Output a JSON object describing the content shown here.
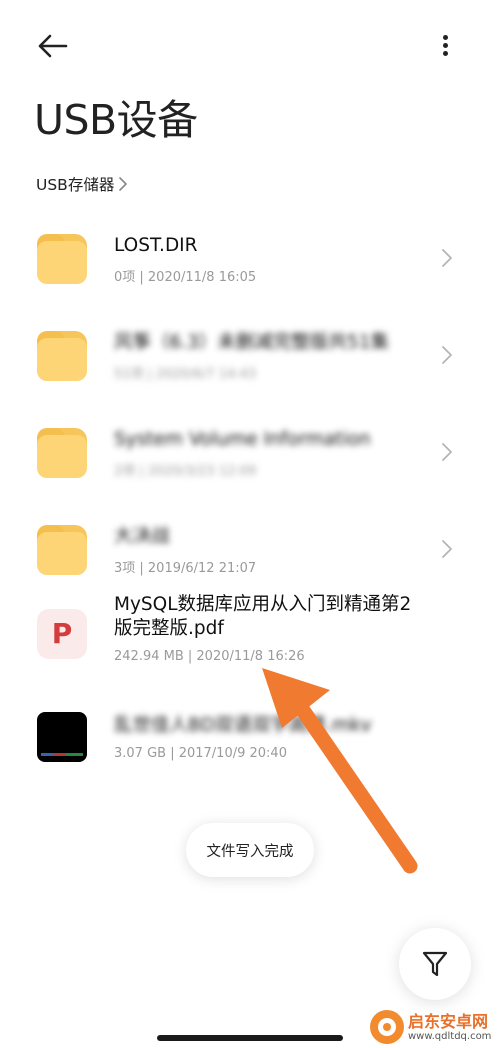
{
  "header": {
    "back_icon": "arrow-left-icon",
    "more_icon": "more-vertical-icon",
    "title": "USB设备"
  },
  "breadcrumb": {
    "label": "USB存储器",
    "chevron_icon": "chevron-right-icon"
  },
  "files": [
    {
      "name": "LOST.DIR",
      "meta": "0项 | 2020/11/8 16:05",
      "type": "folder",
      "blurred": false,
      "has_chevron": true
    },
    {
      "name": "风筝（6.3）未删减完整版共51集",
      "meta": "51项 | 2020/6/7 14:43",
      "type": "folder",
      "blurred": true,
      "has_chevron": true
    },
    {
      "name": "System Volume Information",
      "meta": "2项 | 2020/3/23 12:09",
      "type": "folder",
      "blurred": true,
      "has_chevron": true
    },
    {
      "name": "大决战",
      "meta": "3项 | 2019/6/12 21:07",
      "type": "folder",
      "blurred": true,
      "has_chevron": true
    },
    {
      "name": "MySQL数据库应用从入门到精通第2版完整版.pdf",
      "meta": "242.94 MB | 2020/11/8 16:26",
      "type": "pdf",
      "icon_letter": "P",
      "blurred": false,
      "has_chevron": false
    },
    {
      "name": "乱世佳人BD双语双字高清.mkv",
      "meta": "3.07 GB | 2017/10/9 20:40",
      "type": "video",
      "blurred": true,
      "has_chevron": false
    }
  ],
  "toast": {
    "message": "文件写入完成"
  },
  "fab": {
    "icon": "filter-icon"
  },
  "watermark": {
    "title": "启东安卓网",
    "url": "www.qdltdq.com"
  },
  "colors": {
    "folder": "#fdd577",
    "folder_dark": "#f7c65a",
    "pdf_bg": "#fbeaea",
    "pdf_letter": "#d23c3c",
    "annotation_arrow": "#f07a30",
    "meta_text": "#9a9a9a"
  }
}
